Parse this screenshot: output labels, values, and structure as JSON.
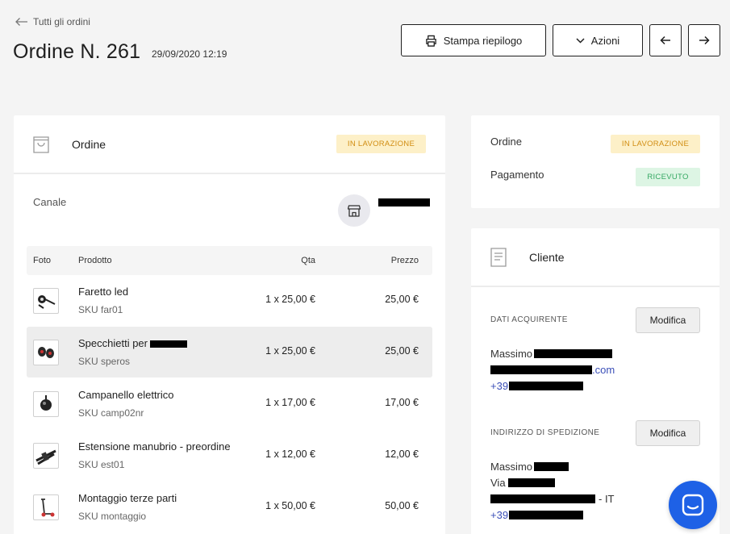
{
  "header": {
    "back_label": "Tutti gli ordini",
    "title": "Ordine N. 261",
    "date": "29/09/2020 12:19",
    "print_label": "Stampa riepilogo",
    "actions_label": "Azioni"
  },
  "order": {
    "title": "Ordine",
    "status": "IN LAVORAZIONE",
    "channel_label": "Canale",
    "columns": {
      "photo": "Foto",
      "product": "Prodotto",
      "qty": "Qta",
      "price": "Prezzo"
    },
    "items": [
      {
        "name": "Faretto led",
        "sku": "SKU far01",
        "qty": "1 x 25,00 €",
        "price": "25,00 €",
        "icon": "led-light-icon"
      },
      {
        "name": "Specchietti per",
        "sku": "SKU speros",
        "qty": "1 x 25,00 €",
        "price": "25,00 €",
        "icon": "mirrors-icon"
      },
      {
        "name": "Campanello elettrico",
        "sku": "SKU camp02nr",
        "qty": "1 x 17,00 €",
        "price": "17,00 €",
        "icon": "bell-icon"
      },
      {
        "name": "Estensione manubrio - preordine",
        "sku": "SKU est01",
        "qty": "1 x 12,00 €",
        "price": "12,00 €",
        "icon": "handlebar-icon"
      },
      {
        "name": "Montaggio terze parti",
        "sku": "SKU montaggio",
        "qty": "1 x 50,00 €",
        "price": "50,00 €",
        "icon": "scooter-icon"
      }
    ]
  },
  "status_card": {
    "order_label": "Ordine",
    "order_status": "IN LAVORAZIONE",
    "payment_label": "Pagamento",
    "payment_status": "RICEVUTO"
  },
  "customer": {
    "title": "Cliente",
    "buyer_section": "DATI ACQUIRENTE",
    "edit_label": "Modifica",
    "buyer_name": "Massimo",
    "buyer_email_suffix": ".com",
    "buyer_phone_prefix": "+39",
    "shipping_section": "INDIRIZZO DI SPEDIZIONE",
    "ship_name": "Massimo",
    "ship_street_prefix": "Via",
    "ship_country_suffix": "- IT",
    "ship_phone_prefix": "+39"
  },
  "colors": {
    "processing_bg": "#fdf0c8",
    "processing_text": "#d18d12",
    "received_bg": "#ddf5e4",
    "received_text": "#35a863",
    "link_blue": "#3b4fb8",
    "chat_blue": "#1e61e6"
  }
}
